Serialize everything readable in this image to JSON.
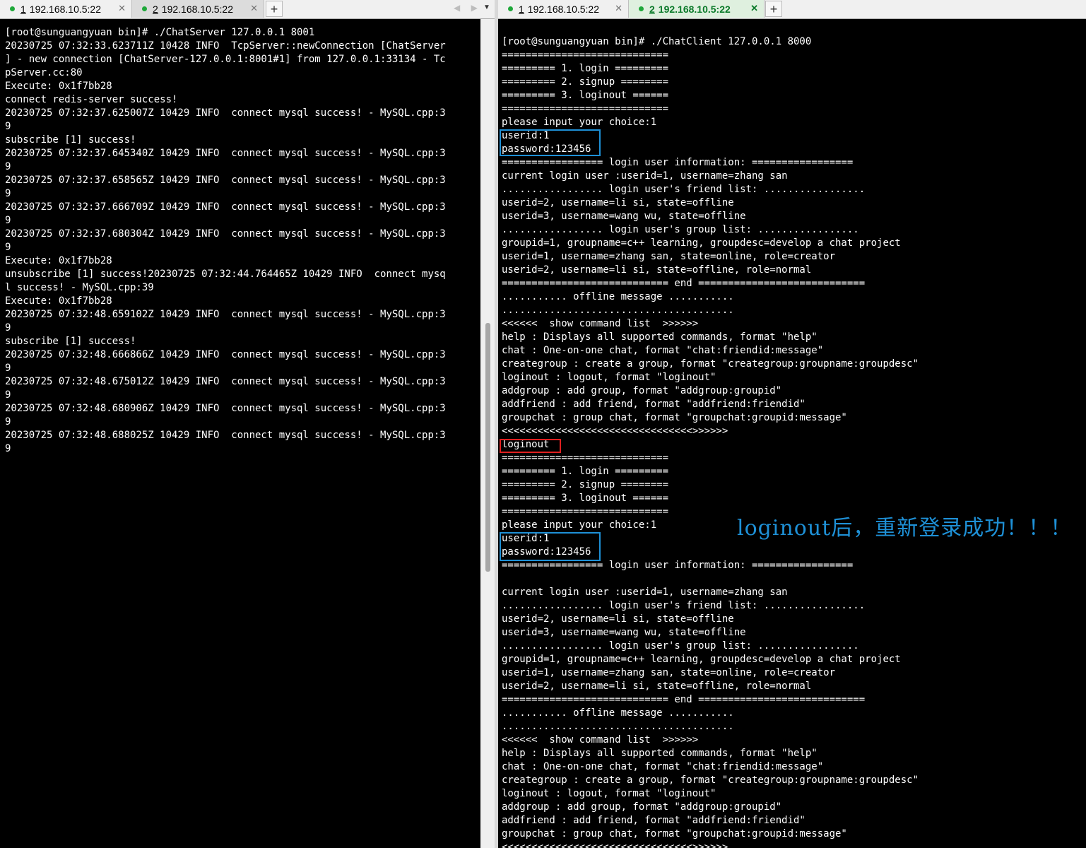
{
  "left_window": {
    "tabs": [
      {
        "num": "1",
        "label": "192.168.10.5:22",
        "close": "✕"
      },
      {
        "num": "2",
        "label": "192.168.10.5:22",
        "close": "✕"
      }
    ],
    "add_tab": "+",
    "nav_arrows": "◀ ▶",
    "menu": "▼",
    "terminal_text": "[root@sunguangyuan bin]# ./ChatServer 127.0.0.1 8001\n20230725 07:32:33.623711Z 10428 INFO  TcpServer::newConnection [ChatServer\n] - new connection [ChatServer-127.0.0.1:8001#1] from 127.0.0.1:33134 - Tc\npServer.cc:80\nExecute: 0x1f7bb28\nconnect redis-server success!\n20230725 07:32:37.625007Z 10429 INFO  connect mysql success! - MySQL.cpp:3\n9\nsubscribe [1] success!\n20230725 07:32:37.645340Z 10429 INFO  connect mysql success! - MySQL.cpp:3\n9\n20230725 07:32:37.658565Z 10429 INFO  connect mysql success! - MySQL.cpp:3\n9\n20230725 07:32:37.666709Z 10429 INFO  connect mysql success! - MySQL.cpp:3\n9\n20230725 07:32:37.680304Z 10429 INFO  connect mysql success! - MySQL.cpp:3\n9\nExecute: 0x1f7bb28\nunsubscribe [1] success!20230725 07:32:44.764465Z 10429 INFO  connect mysq\nl success! - MySQL.cpp:39\nExecute: 0x1f7bb28\n20230725 07:32:48.659102Z 10429 INFO  connect mysql success! - MySQL.cpp:3\n9\nsubscribe [1] success!\n20230725 07:32:48.666866Z 10429 INFO  connect mysql success! - MySQL.cpp:3\n9\n20230725 07:32:48.675012Z 10429 INFO  connect mysql success! - MySQL.cpp:3\n9\n20230725 07:32:48.680906Z 10429 INFO  connect mysql success! - MySQL.cpp:3\n9\n20230725 07:32:48.688025Z 10429 INFO  connect mysql success! - MySQL.cpp:3\n9"
  },
  "right_window": {
    "tabs": [
      {
        "num": "1",
        "label": "192.168.10.5:22",
        "close": "✕"
      },
      {
        "num": "2",
        "label": "192.168.10.5:22",
        "close": "✕"
      }
    ],
    "add_tab": "+",
    "terminal_text": "[root@sunguangyuan bin]# ./ChatClient 127.0.0.1 8000\n============================\n========= 1. login =========\n========= 2. signup ========\n========= 3. loginout ======\n============================\nplease input your choice:1\nuserid:1\npassword:123456\n================= login user information: =================\ncurrent login user :userid=1, username=zhang san\n................. login user's friend list: .................\nuserid=2, username=li si, state=offline\nuserid=3, username=wang wu, state=offline\n................. login user's group list: .................\ngroupid=1, groupname=c++ learning, groupdesc=develop a chat project\nuserid=1, username=zhang san, state=online, role=creator\nuserid=2, username=li si, state=offline, role=normal\n============================ end ============================\n........... offline message ...........\n.......................................\n<<<<<<  show command list  >>>>>>\nhelp : Displays all supported commands, format \"help\"\nchat : One-on-one chat, format \"chat:friendid:message\"\ncreategroup : create a group, format \"creategroup:groupname:groupdesc\"\nloginout : logout, format \"loginout\"\naddgroup : add group, format \"addgroup:groupid\"\naddfriend : add friend, format \"addfriend:friendid\"\ngroupchat : group chat, format \"groupchat:groupid:message\"\n<<<<<<<<<<<<<<<<<<<<<<<<<<<<<<<<>>>>>>\nloginout\n============================\n========= 1. login =========\n========= 2. signup ========\n========= 3. loginout ======\n============================\nplease input your choice:1\nuserid:1\npassword:123456\n================= login user information: =================\n\ncurrent login user :userid=1, username=zhang san\n................. login user's friend list: .................\nuserid=2, username=li si, state=offline\nuserid=3, username=wang wu, state=offline\n................. login user's group list: .................\ngroupid=1, groupname=c++ learning, groupdesc=develop a chat project\nuserid=1, username=zhang san, state=online, role=creator\nuserid=2, username=li si, state=offline, role=normal\n============================ end ============================\n........... offline message ...........\n.......................................\n<<<<<<  show command list  >>>>>>\nhelp : Displays all supported commands, format \"help\"\nchat : One-on-one chat, format \"chat:friendid:message\"\ncreategroup : create a group, format \"creategroup:groupname:groupdesc\"\nloginout : logout, format \"loginout\"\naddgroup : add group, format \"addgroup:groupid\"\naddfriend : add friend, format \"addfriend:friendid\"\ngroupchat : group chat, format \"groupchat:groupid:message\"\n<<<<<<<<<<<<<<<<<<<<<<<<<<<<<<<<>>>>>>"
  },
  "annotation": "loginout后，重新登录成功！！！",
  "colors": {
    "highlight_blue": "#1e90d6",
    "highlight_red": "#e02020",
    "active_tab_text": "#0b7a2a",
    "terminal_bg": "#000000",
    "terminal_fg": "#ffffff"
  }
}
